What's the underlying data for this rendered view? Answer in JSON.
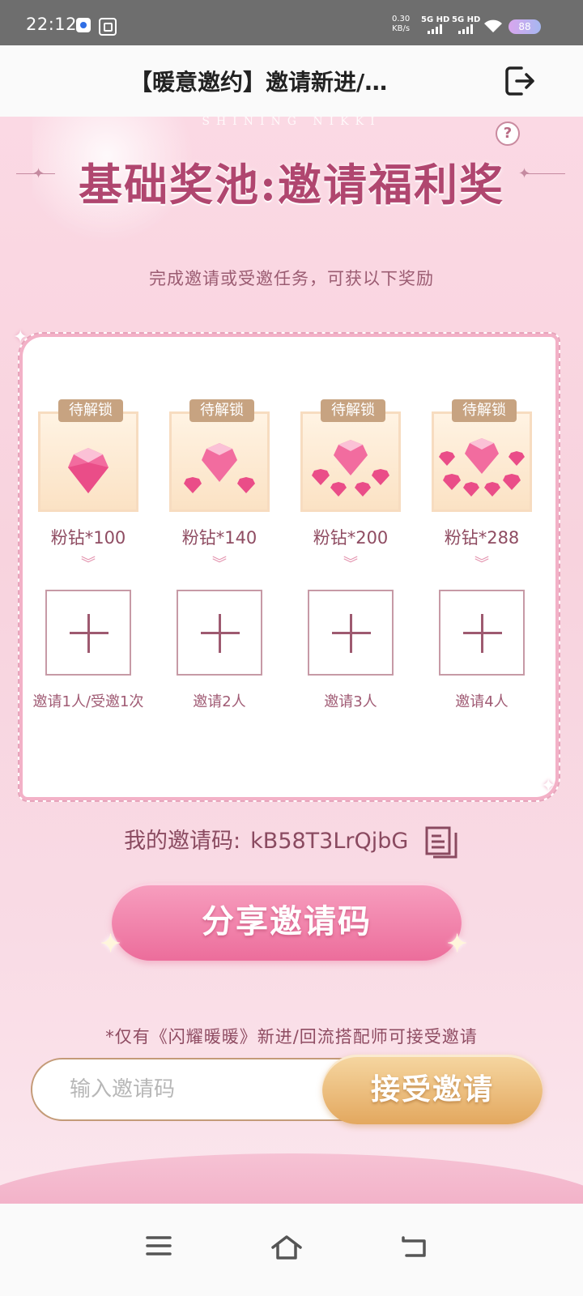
{
  "status_bar": {
    "time": "22:12",
    "speed_value": "0.30",
    "speed_unit": "KB/s",
    "sim1": "5G HD",
    "sim2": "5G HD",
    "battery": "88"
  },
  "header": {
    "title": "【暖意邀约】邀请新进/…",
    "exit_icon": "logout-icon"
  },
  "page": {
    "brand_watermark": "SHINING NIKKI",
    "section_title": "基础奖池:邀请福利奖",
    "subtitle": "完成邀请或受邀任务，可获以下奖励",
    "help_label": "?",
    "rewards": [
      {
        "lock_label": "待解锁",
        "name": "粉钻*100",
        "condition": "邀请1人/受邀1次"
      },
      {
        "lock_label": "待解锁",
        "name": "粉钻*140",
        "condition": "邀请2人"
      },
      {
        "lock_label": "待解锁",
        "name": "粉钻*200",
        "condition": "邀请3人"
      },
      {
        "lock_label": "待解锁",
        "name": "粉钻*288",
        "condition": "邀请4人"
      }
    ],
    "invite_code_label": "我的邀请码:",
    "invite_code": "kB58T3LrQjbG",
    "share_button": "分享邀请码",
    "note": "*仅有《闪耀暖暖》新进/回流搭配师可接受邀请",
    "invite_input_placeholder": "输入邀请码",
    "accept_button": "接受邀请"
  },
  "colors": {
    "accent_pink": "#ec6d9b",
    "accent_gold": "#e3a85f",
    "text_rose": "#8f4c62"
  }
}
